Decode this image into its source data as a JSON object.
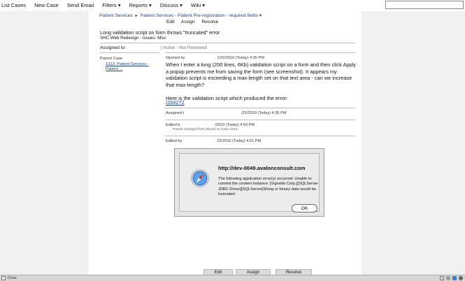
{
  "nav": {
    "items": [
      "List Cases",
      "New Case",
      "Send Email",
      "Filters ▾",
      "Reports ▾",
      "Discuss ▾",
      "Wiki ▾"
    ]
  },
  "breadcrumb": {
    "project": "Patient Services",
    "area": "Patient Services - Patient Pre-registration - required fields",
    "arrow": "▾"
  },
  "actions": {
    "edit": "Edit",
    "assign": "Assign",
    "resolve": "Resolve"
  },
  "case": {
    "title": "Long validation script on form throws \"truncated\" error",
    "subtitle": "SHC Web Redesign - Issues: Misc",
    "assigned_to_label": "Assigned to",
    "status": "| Active - Not Reviewed",
    "parent_label": "Parent Case",
    "parent_link_line1": "1313: Patient Services -",
    "parent_link_line2": "Patient ..."
  },
  "events": {
    "opened_by": "Opened by",
    "opened_date": "1/22/2010 (Today) 4:35 PM",
    "body": "When I enter a long (200 lines, 6Kb) validation script on a form and then click Apply a popup prevents me from saving the form (see screenshot). It appears my validation script is exceeding a max-length set on that text area - can we increase that max-length?\n\nHere is the validation script which produced the error:",
    "body_link": "/284272",
    "assigned_prefix": "Assigned t",
    "assigned_date": "/22/2010 (Today) 4:35 PM",
    "edited1_prefix": "Edited b",
    "edited1_date": "/2010 (Today) 4:50 PM",
    "edited1_note": "Parent changed from (None) to Case 1313.",
    "edited2_prefix": "Edited by",
    "edited2_date": "22/2010 (Today) 4:51 PM"
  },
  "dialog": {
    "title": "http://dev-0049.avalonconsult.com",
    "message": "The following application error(s) occurred: Unable to commit the content instance: [Vignette Corp.][SQLServer JDBC Driver][SQLServer]String or binary data would be truncated.",
    "ok": "OK"
  },
  "bottom_buttons": {
    "edit": "Edit",
    "assign": "Assign",
    "resolve": "Resolve"
  },
  "statusbar": {
    "text": "Done"
  },
  "colors": {
    "link": "#1f3f8c",
    "gutter": "#f1f1f1",
    "status": "#6a7a8a"
  }
}
